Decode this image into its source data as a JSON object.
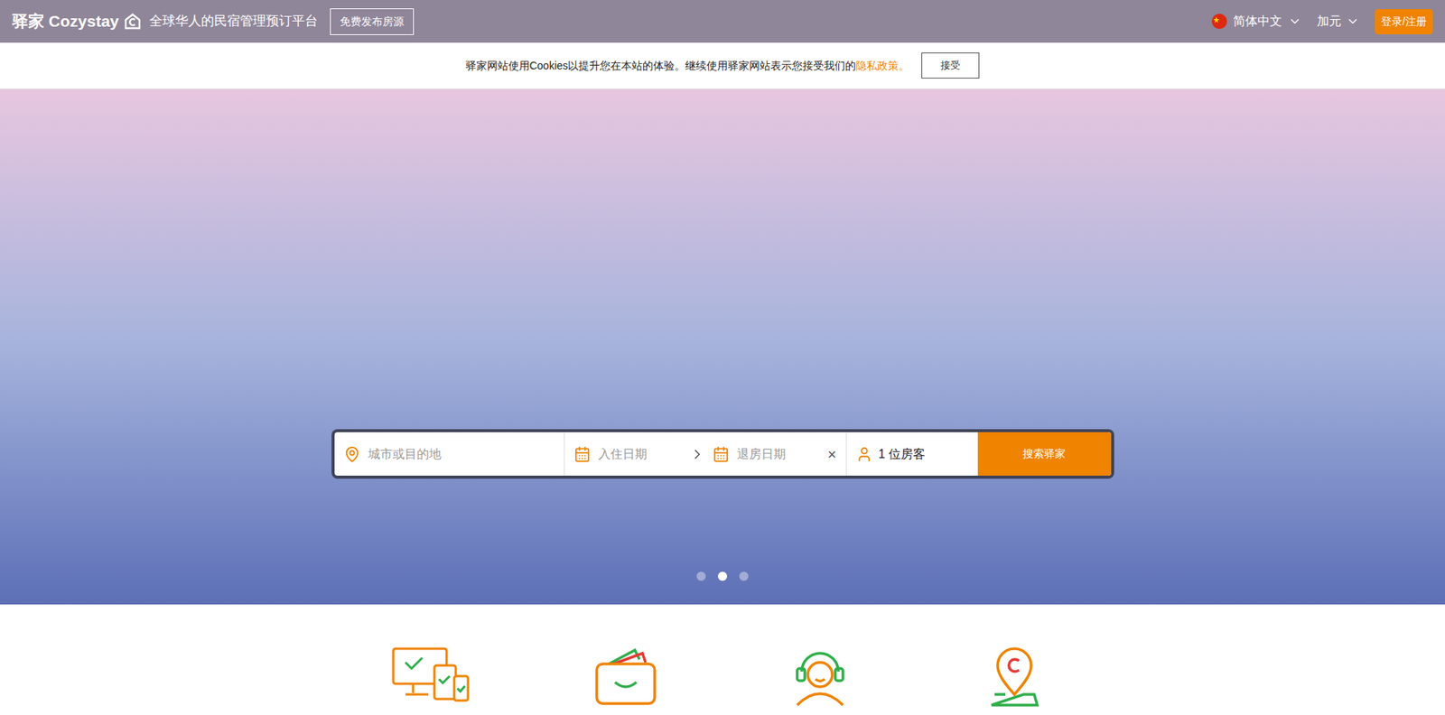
{
  "header": {
    "brand": "驿家 Cozystay",
    "tagline": "全球华人的民宿管理预订平台",
    "publish_button": "免费发布房源",
    "language": "简体中文",
    "currency": "加元",
    "login_button": "登录/注册"
  },
  "cookie_bar": {
    "text": "驿家网站使用Cookies以提升您在本站的体验。继续使用驿家网站表示您接受我们的",
    "link": "隐私政策。",
    "button": "接受"
  },
  "search": {
    "destination_placeholder": "城市或目的地",
    "checkin_placeholder": "入住日期",
    "checkout_placeholder": "退房日期",
    "clear": "×",
    "guests": "1 位房客",
    "button": "搜索驿家"
  },
  "carousel": {
    "dots": [
      {
        "selected": false
      },
      {
        "selected": true
      },
      {
        "selected": false
      }
    ]
  }
}
